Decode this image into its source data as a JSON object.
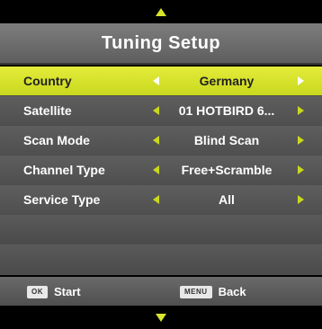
{
  "nav": {
    "up_icon": "triangle-up-icon",
    "down_icon": "triangle-down-icon",
    "accent": "#d7e62c"
  },
  "title": "Tuning Setup",
  "rows": [
    {
      "label": "Country",
      "value": "Germany"
    },
    {
      "label": "Satellite",
      "value": "01 HOTBIRD 6..."
    },
    {
      "label": "Scan Mode",
      "value": "Blind Scan"
    },
    {
      "label": "Channel Type",
      "value": "Free+Scramble"
    },
    {
      "label": "Service Type",
      "value": "All"
    }
  ],
  "selected_row": "Country",
  "footer": {
    "ok_key": "OK",
    "start_label": "Start",
    "menu_key": "MENU",
    "back_label": "Back"
  },
  "colors": {
    "highlight": "#d7e62c",
    "panel": "#5e5e5e",
    "background": "#000000"
  }
}
